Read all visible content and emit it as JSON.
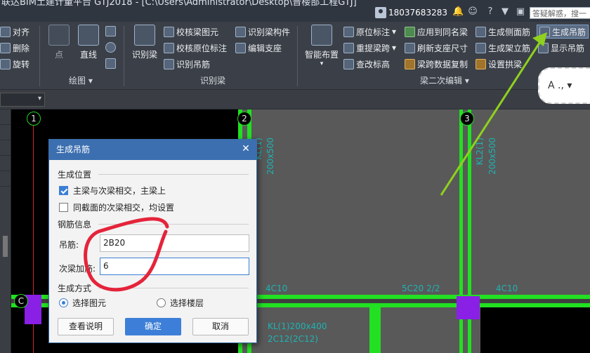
{
  "titlebar": {
    "title": "联达BIM土建计量平台 GTJ2018 - [C:\\Users\\Administrator\\Desktop\\普楼部工程GTJ]",
    "phone": "18037683283",
    "search_placeholder": "答疑解惑，搜一下"
  },
  "ribbon": {
    "modify": {
      "align": "对齐",
      "delete": "删除",
      "rotate": "旋转"
    },
    "draw": {
      "point": "点",
      "line": "直线",
      "group": "绘图"
    },
    "identify": {
      "identify_beam": "识别梁",
      "check_beam_drawing": "校核梁图元",
      "check_origin_annotation": "校核原位标注",
      "identify_hanger": "识别吊筋",
      "identify_beam_member": "识别梁构件",
      "edit_support": "编辑支座",
      "group": "识别梁"
    },
    "edit": {
      "smart_layout": "智能布置",
      "origin_annotation": "原位标注",
      "span_beam": "重提梁跨",
      "check_elevation": "查改标高",
      "apply_same_beam": "应用到同名梁",
      "refresh_support_size": "刷新支座尺寸",
      "span_data_copy": "梁跨数据复制",
      "gen_side_rebar": "生成侧面筋",
      "gen_erect_rebar": "生成架立筋",
      "set_arch": "设置拱梁",
      "gen_hanger": "生成吊筋",
      "show_hanger": "显示吊筋",
      "group": "梁二次编辑"
    }
  },
  "canvas": {
    "axis_labels": [
      "1",
      "2",
      "3",
      "C"
    ],
    "texts": [
      "KL(1)",
      "200x500",
      "KL2(1)",
      "200x500",
      "4C10",
      "5C20 2/2",
      "4C10",
      "KL(1)200x400",
      "2C12(2C12)"
    ]
  },
  "dialog": {
    "title": "生成吊筋",
    "position_section": "生成位置",
    "opt_main_secondary": "主梁与次梁相交，主梁上",
    "opt_same_section": "同截面的次梁相交，均设置",
    "opt_main_checked": true,
    "opt_same_checked": false,
    "rebar_section": "钢筋信息",
    "hanger_label": "吊筋:",
    "hanger_value": "2B20",
    "secondary_label": "次梁加筋:",
    "secondary_value": "6",
    "method_section": "生成方式",
    "radio_select_element": "选择图元",
    "radio_select_floor": "选择楼层",
    "radio_selected": "选择图元",
    "btn_help": "查看说明",
    "btn_ok": "确定",
    "btn_cancel": "取消"
  },
  "tooltip_bubble": "A .,",
  "colors": {
    "canvas_bg": "#595959",
    "beam_green": "#22e022",
    "dialog_title": "#3c6fb0",
    "primary_button": "#3d7fd8",
    "annotation_red": "#e4243b",
    "annotation_arrow": "#8fd11e",
    "rebar_text": "#1fb3b3",
    "support_purple": "#8a1fe6"
  }
}
